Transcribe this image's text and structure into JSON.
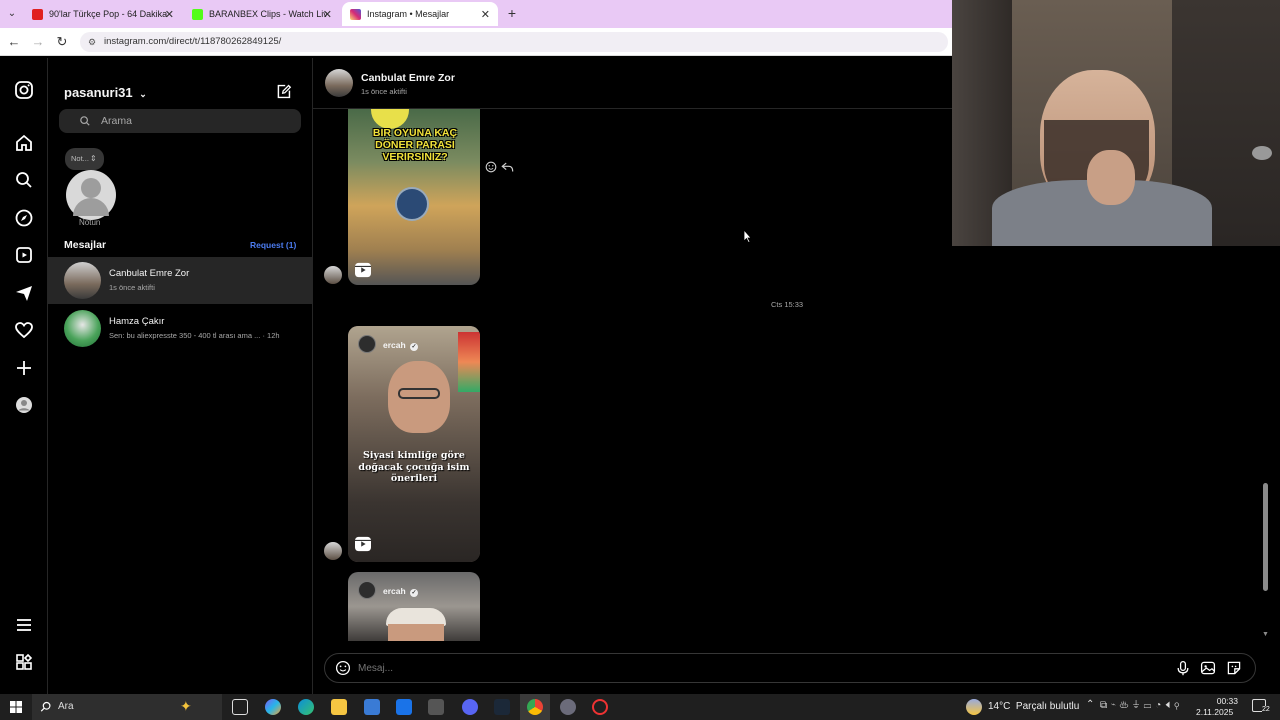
{
  "browser": {
    "tabs": [
      {
        "title": "90'lar Türkçe Pop - 64 Dakika /",
        "favicon_color": "#e02020"
      },
      {
        "title": "BARANBEX Clips - Watch Live o",
        "favicon_color": "#53fc18"
      },
      {
        "title": "Instagram • Mesajlar",
        "favicon_color": "#d62976"
      }
    ],
    "url": "instagram.com/direct/t/118780262849125/"
  },
  "sidebar": {
    "username": "pasanuri31",
    "search_placeholder": "Arama",
    "note_bubble": "Not...",
    "note_label": "Notun",
    "messages_header": "Mesajlar",
    "requests_label": "Request (1)",
    "conversations": [
      {
        "name": "Canbulat Emre Zor",
        "preview": "1s önce aktifti",
        "selected": true
      },
      {
        "name": "Hamza Çakır",
        "preview": "Sen: bu aliexpresste 350 - 400 tl arası ama ...",
        "time": "· 12h",
        "selected": false
      }
    ]
  },
  "chat": {
    "contact_name": "Canbulat Emre Zor",
    "contact_status": "1s önce aktifti",
    "reel1_text": "BIR OYUNA KAÇ DÖNER PARASI VERIRSINIZ?",
    "timestamp": "Cts 15:33",
    "reel2_user": "ercah",
    "reel2_caption": "Siyasi kimliğe göre doğacak çocuğa isim önerileri",
    "reel3_user": "ercah",
    "message_placeholder": "Mesaj..."
  },
  "taskbar": {
    "search_label": "Ara",
    "weather": "14°C  Parçalı bulutlu",
    "time": "00:33",
    "date": "2.11.2025",
    "notification_count": "22"
  },
  "colors": {
    "accent_blue": "#4c7cf0",
    "tab_bar": "#e9c9f5",
    "selected_row": "#262626"
  }
}
